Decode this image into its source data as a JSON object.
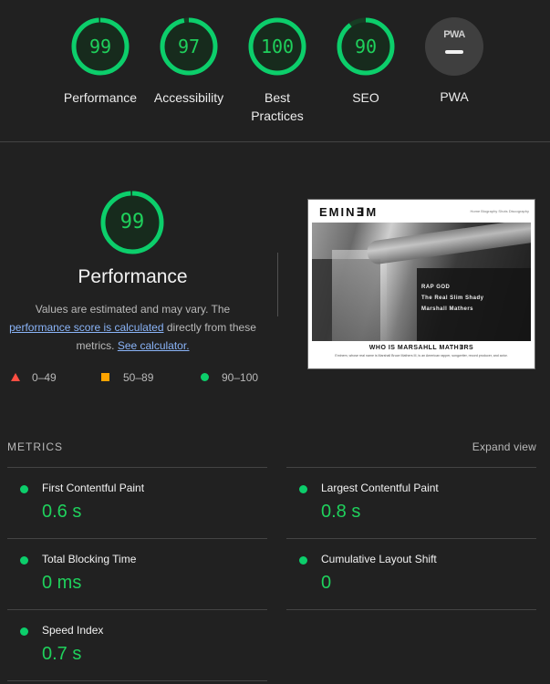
{
  "gauges": [
    {
      "score": "99",
      "label": "Performance",
      "fraction": 0.99
    },
    {
      "score": "97",
      "label": "Accessibility",
      "fraction": 0.97
    },
    {
      "score": "100",
      "label": "Best Practices",
      "fraction": 1.0
    },
    {
      "score": "90",
      "label": "SEO",
      "fraction": 0.9
    }
  ],
  "pwa": {
    "badge": "PWA",
    "label": "PWA"
  },
  "performance": {
    "score": "99",
    "fraction": 0.99,
    "title": "Performance",
    "desc_part1": "Values are estimated and may vary. The ",
    "desc_link1": "performance score is calculated",
    "desc_part2": " directly from these metrics. ",
    "desc_link2": "See calculator."
  },
  "legend": [
    {
      "range": "0–49",
      "shape": "triangle",
      "color": "#ff4e42"
    },
    {
      "range": "50–89",
      "shape": "square",
      "color": "#ffa400"
    },
    {
      "range": "90–100",
      "shape": "circle",
      "color": "#0cce6b"
    }
  ],
  "screenshot": {
    "logo": "EMIN∃M",
    "nav": "Home  Biography  Shots  Discography",
    "hero_lines": [
      "RAP GOD",
      "The Real Slim Shady",
      "Marshall Mathers"
    ],
    "title": "WHO IS MARSAHLL MATH∃RS",
    "text": "Eminem, whose real name is Marshall Bruce Mathers III, is an American rapper, songwriter, record producer, and actor."
  },
  "metrics": {
    "heading": "METRICS",
    "expand_label": "Expand view",
    "items": [
      {
        "name": "First Contentful Paint",
        "value": "0.6 s"
      },
      {
        "name": "Largest Contentful Paint",
        "value": "0.8 s"
      },
      {
        "name": "Total Blocking Time",
        "value": "0 ms"
      },
      {
        "name": "Cumulative Layout Shift",
        "value": "0"
      },
      {
        "name": "Speed Index",
        "value": "0.7 s"
      }
    ]
  },
  "colors": {
    "pass": "#0cce6b",
    "score_text": "#1fd15c",
    "average": "#ffa400",
    "fail": "#ff4e42",
    "link": "#8ab4f8",
    "background": "#212121"
  }
}
